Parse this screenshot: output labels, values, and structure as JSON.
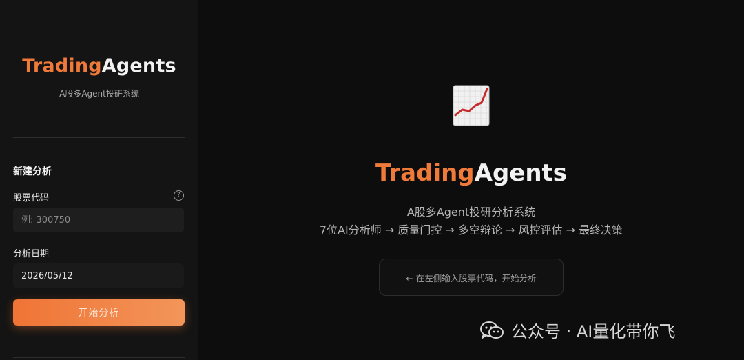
{
  "sidebar": {
    "brand_part1": "Trading",
    "brand_part2": "Agents",
    "brand_sub": "A股多Agent投研系统",
    "section_title": "新建分析",
    "stock_label": "股票代码",
    "stock_placeholder": "例: 300750",
    "date_label": "分析日期",
    "date_value": "2026/05/12",
    "start_button": "开始分析",
    "help_icon": "help-circle-icon"
  },
  "main": {
    "icon": "chart-increasing-icon",
    "title_part1": "Trading",
    "title_part2": "Agents",
    "subtitle": "A股多Agent投研分析系统",
    "pipeline": "7位AI分析师 → 质量门控 → 多空辩论 → 风控评估 → 最终决策",
    "hint": "← 在左侧输入股票代码，开始分析"
  },
  "watermark": {
    "text": "公众号 · AI量化带你飞",
    "icon": "wechat-icon"
  },
  "colors": {
    "accent": "#f07a3a",
    "background": "#0d0d0d",
    "sidebar": "#141414"
  }
}
